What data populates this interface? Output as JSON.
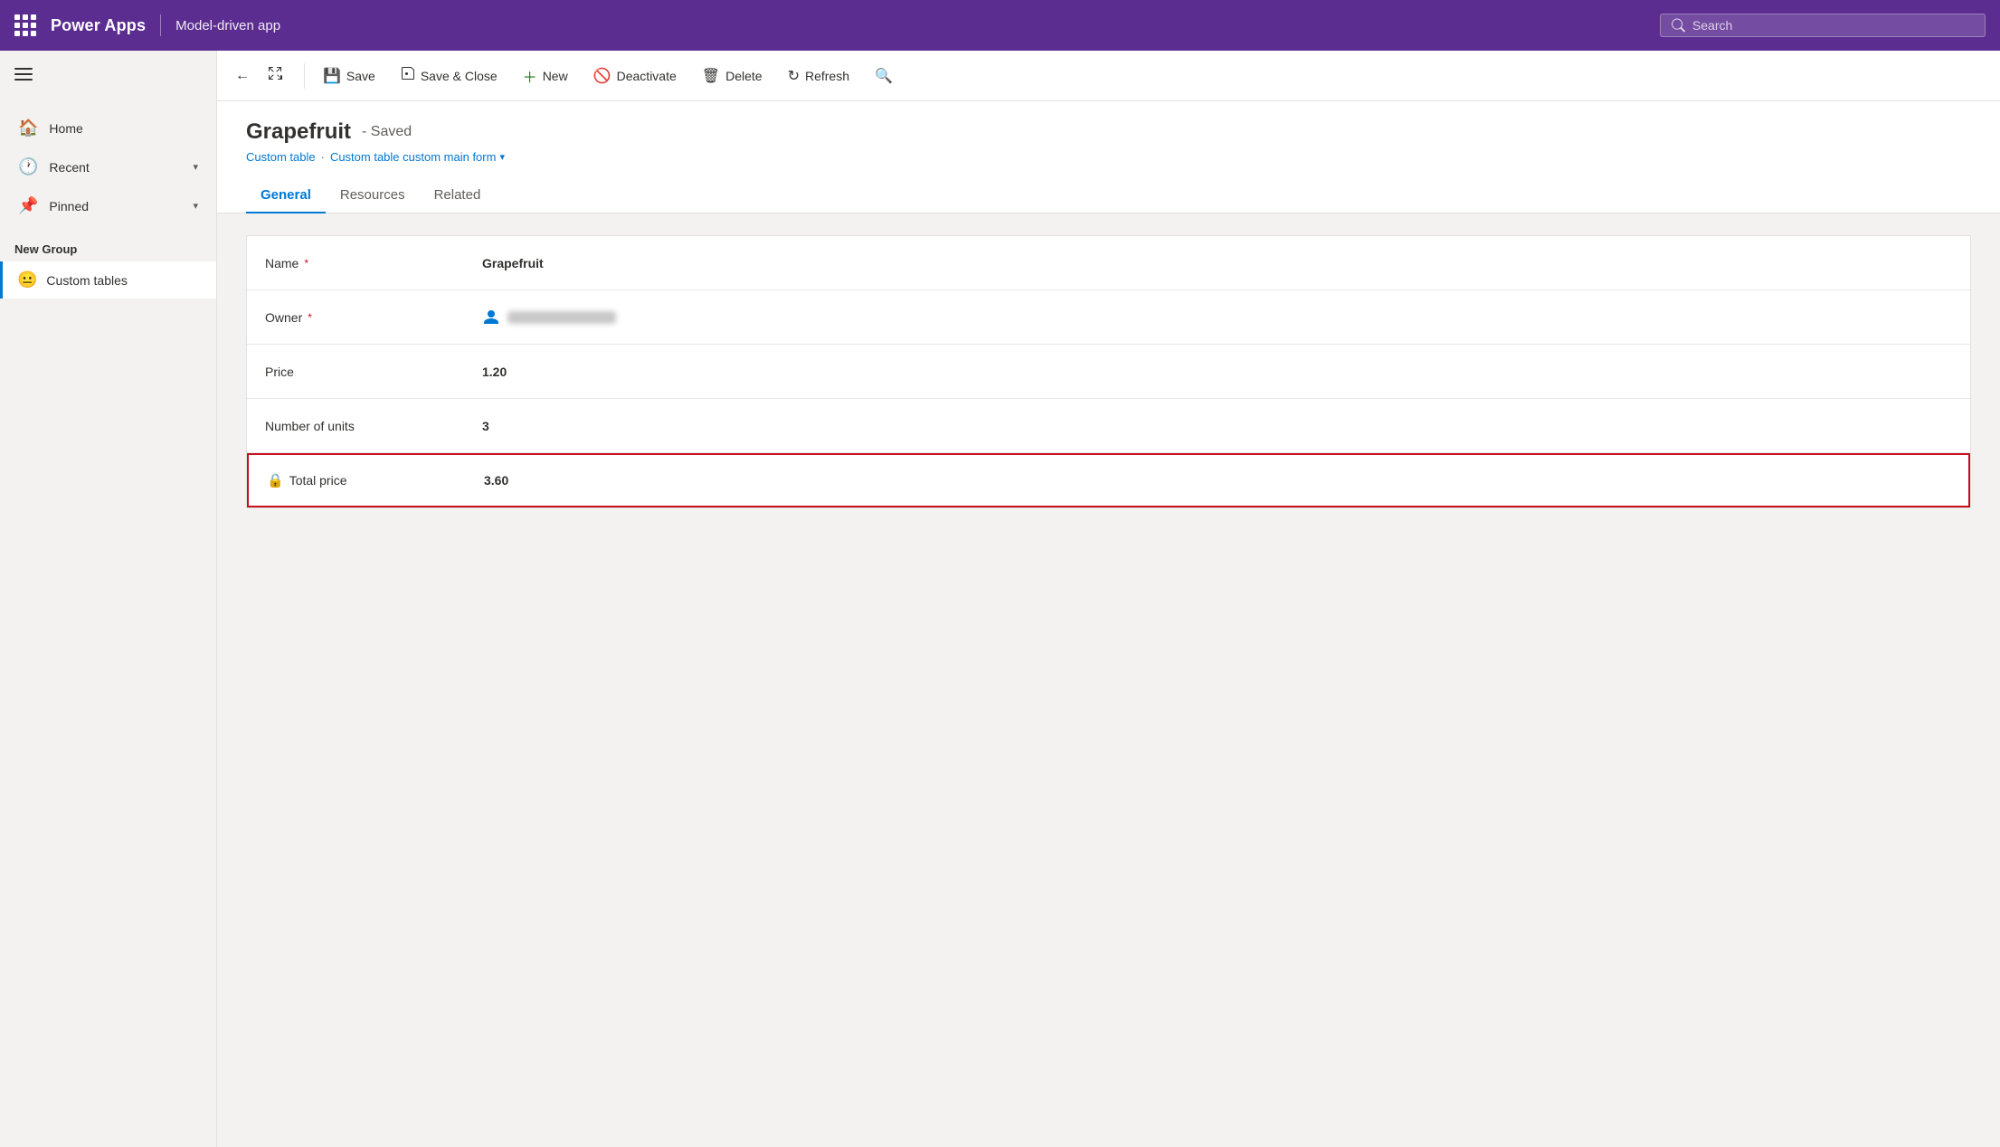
{
  "topbar": {
    "app_title": "Power Apps",
    "app_subtitle": "Model-driven app",
    "search_placeholder": "Search"
  },
  "sidebar": {
    "nav_items": [
      {
        "id": "home",
        "icon": "🏠",
        "label": "Home"
      },
      {
        "id": "recent",
        "icon": "🕐",
        "label": "Recent",
        "has_chevron": true
      },
      {
        "id": "pinned",
        "icon": "📌",
        "label": "Pinned",
        "has_chevron": true
      }
    ],
    "section_label": "New Group",
    "custom_items": [
      {
        "id": "custom-tables",
        "emoji": "😐",
        "label": "Custom tables"
      }
    ]
  },
  "toolbar": {
    "back_label": "←",
    "expand_label": "⤢",
    "save_label": "Save",
    "save_close_label": "Save & Close",
    "new_label": "New",
    "deactivate_label": "Deactivate",
    "delete_label": "Delete",
    "refresh_label": "Refresh",
    "search_label": "🔍"
  },
  "record": {
    "title": "Grapefruit",
    "status": "- Saved",
    "breadcrumb_table": "Custom table",
    "breadcrumb_form": "Custom table custom main form"
  },
  "tabs": [
    {
      "id": "general",
      "label": "General",
      "active": true
    },
    {
      "id": "resources",
      "label": "Resources",
      "active": false
    },
    {
      "id": "related",
      "label": "Related",
      "active": false
    }
  ],
  "form": {
    "fields": [
      {
        "id": "name",
        "label": "Name",
        "required": true,
        "value": "Grapefruit",
        "type": "text"
      },
      {
        "id": "owner",
        "label": "Owner",
        "required": true,
        "value": "",
        "type": "owner"
      },
      {
        "id": "price",
        "label": "Price",
        "required": false,
        "value": "1.20",
        "type": "text"
      },
      {
        "id": "number-of-units",
        "label": "Number of units",
        "required": false,
        "value": "3",
        "type": "text"
      },
      {
        "id": "total-price",
        "label": "Total price",
        "required": false,
        "value": "3.60",
        "type": "locked",
        "highlighted": true
      }
    ]
  }
}
